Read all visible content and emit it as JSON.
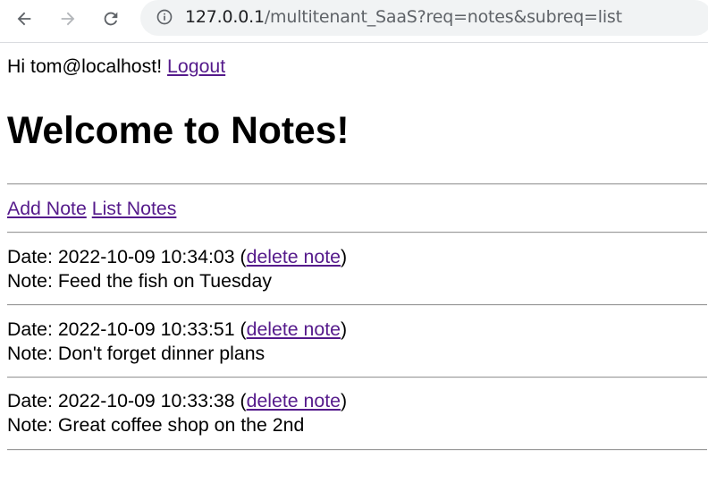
{
  "browser": {
    "url_host": "127.0.0.1",
    "url_path": "/multitenant_SaaS?req=notes&subreq=list",
    "back_icon": "arrow-left-icon",
    "forward_icon": "arrow-right-icon",
    "reload_icon": "reload-icon",
    "info_icon": "info-icon"
  },
  "header": {
    "greeting": "Hi tom@localhost!",
    "logout_label": "Logout"
  },
  "page": {
    "title": "Welcome to Notes!"
  },
  "menu": {
    "add_note": "Add Note",
    "list_notes": "List Notes"
  },
  "notes": [
    {
      "date_prefix": "Date: 2022-10-09 10:34:03 (",
      "delete_label": "delete note",
      "date_suffix": ")",
      "note_text": "Note: Feed the fish on Tuesday"
    },
    {
      "date_prefix": "Date: 2022-10-09 10:33:51 (",
      "delete_label": "delete note",
      "date_suffix": ")",
      "note_text": "Note: Don't forget dinner plans"
    },
    {
      "date_prefix": "Date: 2022-10-09 10:33:38 (",
      "delete_label": "delete note",
      "date_suffix": ")",
      "note_text": "Note: Great coffee shop on the 2nd"
    }
  ],
  "colors": {
    "link": "#551a8b",
    "omnibox": "#f1f3f4",
    "rule": "#9a9a9a"
  }
}
